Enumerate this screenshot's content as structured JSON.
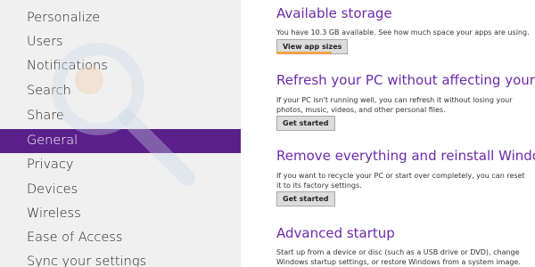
{
  "sidebar": {
    "items": [
      {
        "label": "Personalize"
      },
      {
        "label": "Users"
      },
      {
        "label": "Notifications"
      },
      {
        "label": "Search"
      },
      {
        "label": "Share"
      },
      {
        "label": "General",
        "selected": true
      },
      {
        "label": "Privacy"
      },
      {
        "label": "Devices"
      },
      {
        "label": "Wireless"
      },
      {
        "label": "Ease of Access"
      },
      {
        "label": "Sync your settings"
      }
    ]
  },
  "main": {
    "storage": {
      "title": "Available storage",
      "desc": "You have 10.3 GB available. See how much space your apps are using.",
      "button": "View app sizes"
    },
    "refresh": {
      "title": "Refresh your PC without affecting your files",
      "desc": "If your PC isn't running well, you can refresh it without losing your photos, music, videos, and other personal files.",
      "button": "Get started"
    },
    "reinstall": {
      "title": "Remove everything and reinstall Windows",
      "desc": "If you want to recycle your PC or start over completely, you can reset it to its factory settings.",
      "button": "Get started"
    },
    "advanced": {
      "title": "Advanced startup",
      "desc": "Start up from a device or disc (such as a USB drive or DVD), change Windows startup settings, or restore Windows from a system image. This will restart your PC."
    }
  },
  "colors": {
    "accent": "#6b2ba8",
    "selected_bg": "#5b1f8a",
    "highlight": "#f0a34a"
  }
}
